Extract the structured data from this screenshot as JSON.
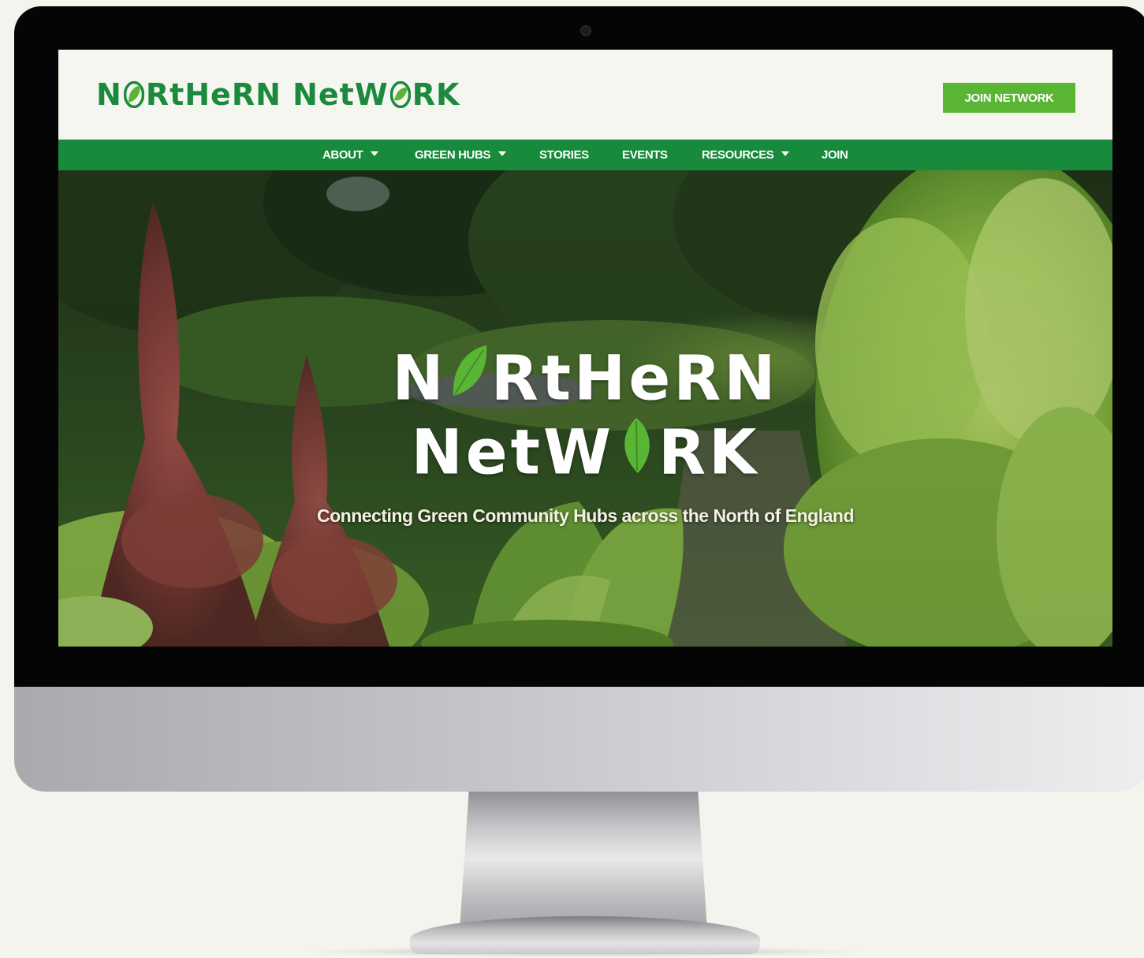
{
  "site": {
    "logo_text_before": "N",
    "logo_text_after": "RtHeRN NetW",
    "logo_text_end": "RK",
    "join_button_label": "JOIN NETWORK",
    "brand_green": "#178a3b",
    "accent_green": "#5bb535"
  },
  "nav": {
    "items": [
      {
        "label": "ABOUT",
        "has_dropdown": true
      },
      {
        "label": "GREEN HUBS",
        "has_dropdown": true
      },
      {
        "label": "STORIES",
        "has_dropdown": false
      },
      {
        "label": "EVENTS",
        "has_dropdown": false
      },
      {
        "label": "RESOURCES",
        "has_dropdown": true
      },
      {
        "label": "JOIN",
        "has_dropdown": false
      }
    ]
  },
  "hero": {
    "title_line1_before": "N",
    "title_line1_after": "RtHeRN",
    "title_line2_before": "NetW",
    "title_line2_after": "RK",
    "tagline": "Connecting Green Community Hubs across the North of England",
    "background": "garden with lettuces and red lettuce flowers"
  }
}
